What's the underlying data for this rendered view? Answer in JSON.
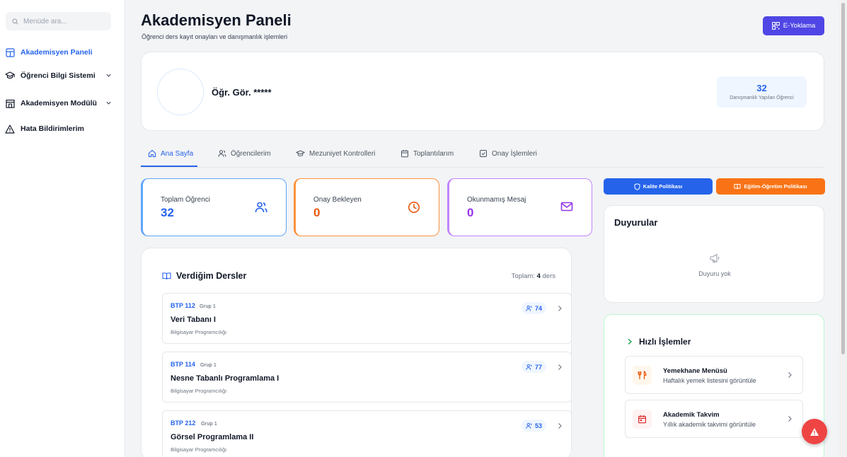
{
  "sidebar": {
    "search_placeholder": "Menüde ara...",
    "items": [
      {
        "label": "Akademisyen Paneli",
        "icon": "dashboard-icon",
        "active": true
      },
      {
        "label": "Öğrenci Bilgi Sistemi",
        "icon": "graduation-cap-icon",
        "has_submenu": true
      },
      {
        "label": "Akademisyen Modülü",
        "icon": "building-icon",
        "has_submenu": true
      },
      {
        "label": "Hata Bildirimlerim",
        "icon": "warning-icon"
      }
    ]
  },
  "header": {
    "title": "Akademisyen Paneli",
    "subtitle": "Öğrenci ders kayıt onayları ve danışmanlık işlemleri",
    "e_yoklama_label": "E-Yoklama"
  },
  "profile": {
    "name": "Öğr. Gör. *****",
    "advised_count": "32",
    "advised_label": "Danışmanlık Yapılan Öğrenci"
  },
  "tabs": [
    {
      "label": "Ana Sayfa",
      "icon": "home-icon",
      "active": true
    },
    {
      "label": "Öğrencilerim",
      "icon": "users-icon"
    },
    {
      "label": "Mezuniyet Kontrolleri",
      "icon": "graduation-cap-icon"
    },
    {
      "label": "Toplantılarım",
      "icon": "calendar-icon"
    },
    {
      "label": "Onay İşlemleri",
      "icon": "check-square-icon"
    }
  ],
  "stats": [
    {
      "title": "Toplam Öğrenci",
      "value": "32",
      "icon": "users-icon",
      "color": "#2563eb",
      "border": "#60a5fa"
    },
    {
      "title": "Onay Bekleyen",
      "value": "0",
      "icon": "clock-icon",
      "color": "#ea580c",
      "border": "#fb923c"
    },
    {
      "title": "Okunmamış Mesaj",
      "value": "0",
      "icon": "mail-icon",
      "color": "#9333ea",
      "border": "#c084fc"
    }
  ],
  "courses": {
    "title": "Verdiğim Dersler",
    "total_prefix": "Toplam:",
    "total_count": "4",
    "total_suffix": "ders",
    "items": [
      {
        "code": "BTP 112",
        "group": "Grup 1",
        "name": "Veri Tabanı I",
        "dept": "Bilgisayar Programcılığı",
        "students": "74"
      },
      {
        "code": "BTP 114",
        "group": "Grup 1",
        "name": "Nesne Tabanlı Programlama I",
        "dept": "Bilgisayar Programcılığı",
        "students": "77"
      },
      {
        "code": "BTP 212",
        "group": "Grup 1",
        "name": "Görsel Programlama II",
        "dept": "Bilgisayar Programcılığı",
        "students": "53"
      }
    ]
  },
  "policies": {
    "quality_label": "Kalite Politikası",
    "education_label": "Eğitim-Öğretim Politikası",
    "quality_color": "#2563eb",
    "education_color": "#f97316"
  },
  "announcements": {
    "title": "Duyurular",
    "empty_text": "Duyuru yok"
  },
  "quick_actions": {
    "title": "Hızlı İşlemler",
    "items": [
      {
        "title": "Yemekhane Menüsü",
        "subtitle": "Haftalık yemek listesini görüntüle",
        "icon": "utensils-icon"
      },
      {
        "title": "Akademik Takvim",
        "subtitle": "Yıllık akademik takvimi görüntüle",
        "icon": "calendar-icon"
      }
    ]
  }
}
